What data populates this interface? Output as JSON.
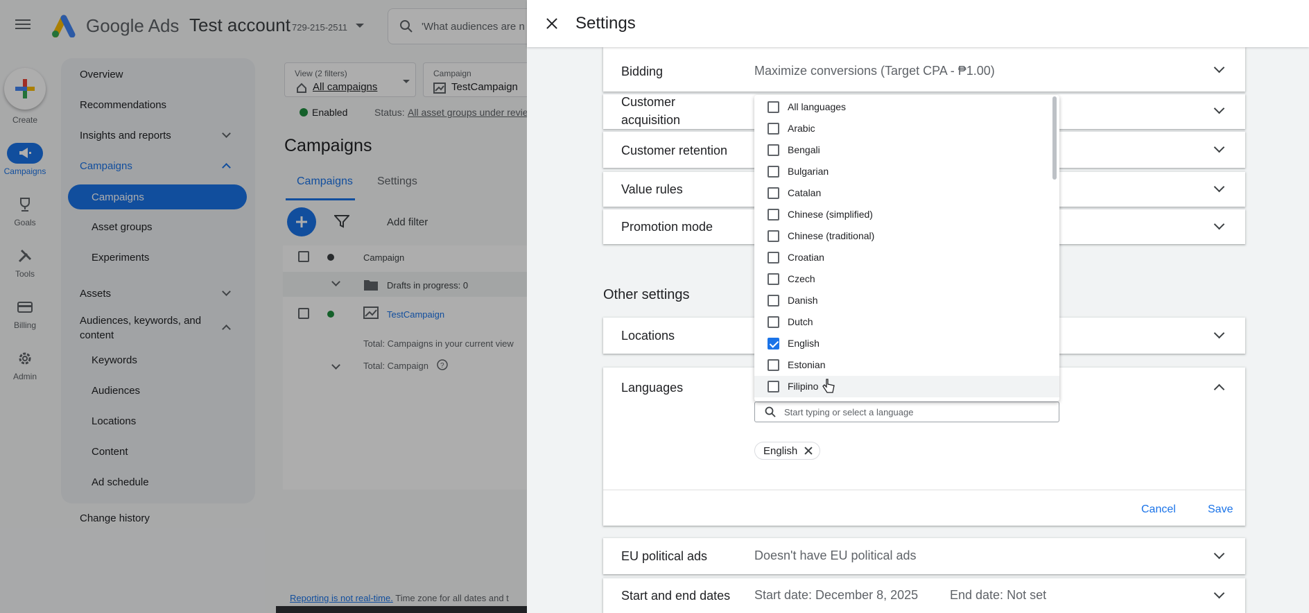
{
  "app": {
    "brand": "Google Ads",
    "account_name": "Test account",
    "account_id": "729-215-2511",
    "search_placeholder": "'What audiences are n"
  },
  "rail": [
    {
      "label": "Create"
    },
    {
      "label": "Campaigns"
    },
    {
      "label": "Goals"
    },
    {
      "label": "Tools"
    },
    {
      "label": "Billing"
    },
    {
      "label": "Admin"
    }
  ],
  "nav": {
    "overview": "Overview",
    "recommendations": "Recommendations",
    "insights": "Insights and reports",
    "campaigns": "Campaigns",
    "campaigns_active": "Campaigns",
    "asset_groups": "Asset groups",
    "experiments": "Experiments",
    "assets": "Assets",
    "audiences_section": "Audiences, keywords, and content",
    "keywords": "Keywords",
    "audiences": "Audiences",
    "locations": "Locations",
    "content": "Content",
    "ad_schedule": "Ad schedule",
    "change_history": "Change history"
  },
  "main": {
    "view_label": "View (2 filters)",
    "view_value": "All campaigns",
    "campaign_label": "Campaign",
    "campaign_value": "TestCampaign",
    "status_enabled": "Enabled",
    "status_text": "Status:",
    "status_link": "All asset groups under revie",
    "page_title": "Campaigns",
    "tab_campaigns": "Campaigns",
    "tab_settings": "Settings",
    "add_filter": "Add filter",
    "col_campaign": "Campaign",
    "drafts": "Drafts in progress: 0",
    "campaign_row": "TestCampaign",
    "total_view": "Total: Campaigns in your current view",
    "total_campaign": "Total: Campaign",
    "footer_link": "Reporting is not real-time.",
    "footer_text": "Time zone for all dates and t"
  },
  "panel": {
    "title": "Settings",
    "bidding_label": "Bidding",
    "bidding_value": "Maximize conversions (Target CPA - ₱1.00)",
    "customer_acquisition": "Customer acquisition",
    "customer_retention": "Customer retention",
    "value_rules": "Value rules",
    "promotion_mode": "Promotion mode",
    "other_settings": "Other settings",
    "locations": "Locations",
    "languages": "Languages",
    "lang_search_placeholder": "Start typing or select a language",
    "selected_tag": "English",
    "cancel": "Cancel",
    "save": "Save",
    "eu_label": "EU political ads",
    "eu_value": "Doesn't have EU political ads",
    "dates_label": "Start and end dates",
    "start_date": "Start date: December 8, 2025",
    "end_date": "End date: Not set"
  },
  "languages": [
    {
      "label": "All languages",
      "checked": false
    },
    {
      "label": "Arabic",
      "checked": false
    },
    {
      "label": "Bengali",
      "checked": false
    },
    {
      "label": "Bulgarian",
      "checked": false
    },
    {
      "label": "Catalan",
      "checked": false
    },
    {
      "label": "Chinese (simplified)",
      "checked": false
    },
    {
      "label": "Chinese (traditional)",
      "checked": false
    },
    {
      "label": "Croatian",
      "checked": false
    },
    {
      "label": "Czech",
      "checked": false
    },
    {
      "label": "Danish",
      "checked": false
    },
    {
      "label": "Dutch",
      "checked": false
    },
    {
      "label": "English",
      "checked": true
    },
    {
      "label": "Estonian",
      "checked": false
    },
    {
      "label": "Filipino",
      "checked": false
    }
  ],
  "colors": {
    "accent": "#1a73e8",
    "enabled_dot": "#1e8e3e"
  }
}
